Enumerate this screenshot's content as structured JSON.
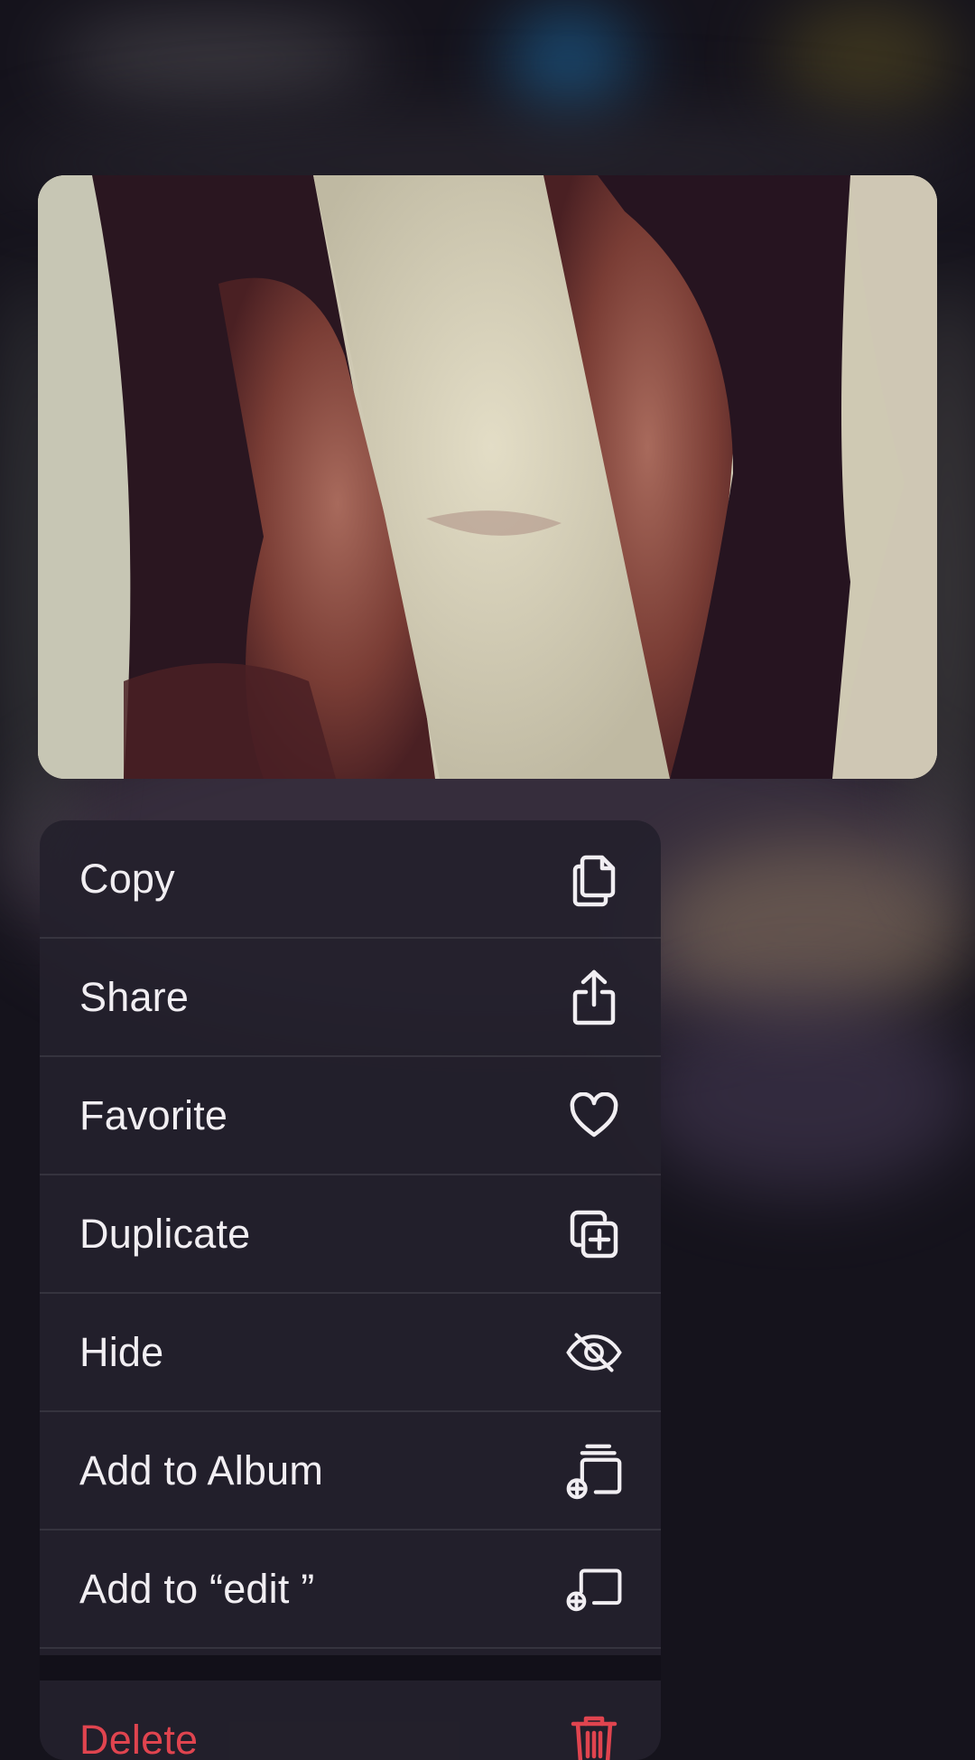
{
  "menu": {
    "items": [
      {
        "label": "Copy",
        "icon": "copy-icon"
      },
      {
        "label": "Share",
        "icon": "share-icon"
      },
      {
        "label": "Favorite",
        "icon": "heart-icon"
      },
      {
        "label": "Duplicate",
        "icon": "duplicate-icon"
      },
      {
        "label": "Hide",
        "icon": "eye-slash-icon"
      },
      {
        "label": "Add to Album",
        "icon": "add-to-album-icon"
      },
      {
        "label": "Add to “edit ”",
        "icon": "add-to-edit-album-icon"
      }
    ],
    "destructive": {
      "label": "Delete",
      "icon": "trash-icon"
    }
  },
  "colors": {
    "menu_text": "#f1eef2",
    "destructive": "#e0444f",
    "menu_bg": "#24212c"
  }
}
